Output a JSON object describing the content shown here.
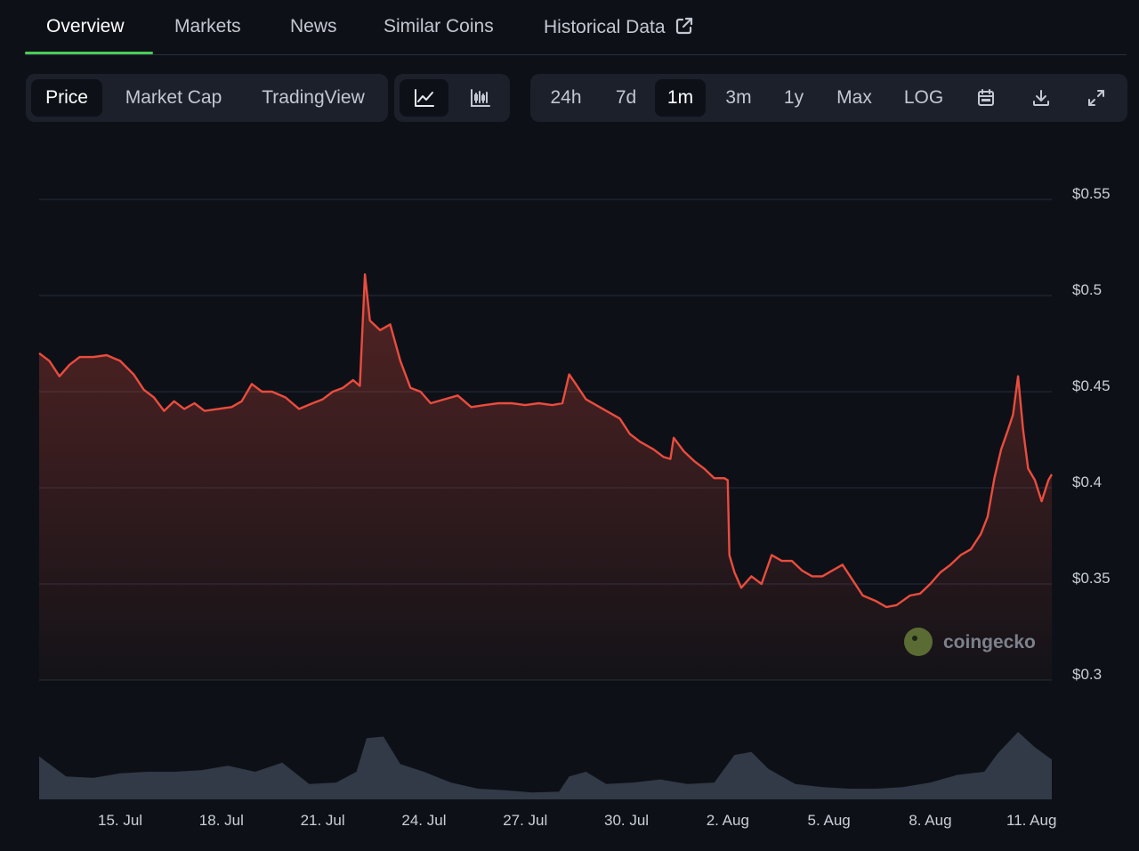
{
  "tabs": [
    {
      "label": "Overview",
      "active": true
    },
    {
      "label": "Markets",
      "active": false
    },
    {
      "label": "News",
      "active": false
    },
    {
      "label": "Similar Coins",
      "active": false
    },
    {
      "label": "Historical Data",
      "active": false
    }
  ],
  "view_toggle": [
    {
      "label": "Price",
      "active": true
    },
    {
      "label": "Market Cap",
      "active": false
    },
    {
      "label": "TradingView",
      "active": false
    }
  ],
  "chart_type_toggle": [
    {
      "icon": "line-chart-icon",
      "active": true
    },
    {
      "icon": "candlestick-chart-icon",
      "active": false
    }
  ],
  "range_toggle": [
    {
      "label": "24h",
      "active": false
    },
    {
      "label": "7d",
      "active": false
    },
    {
      "label": "1m",
      "active": true
    },
    {
      "label": "3m",
      "active": false
    },
    {
      "label": "1y",
      "active": false
    },
    {
      "label": "Max",
      "active": false
    },
    {
      "label": "LOG",
      "active": false
    }
  ],
  "tool_icons": [
    "calendar-icon",
    "download-icon",
    "fullscreen-icon"
  ],
  "watermark": "coingecko",
  "colors": {
    "line": "#ea4c3e",
    "volume": "#3a4250",
    "accent": "#4bcc57",
    "background": "#0d1117"
  },
  "chart_data": {
    "type": "line",
    "y_ticks": [
      {
        "value": 0.55,
        "label": "$0.55"
      },
      {
        "value": 0.5,
        "label": "$0.5"
      },
      {
        "value": 0.45,
        "label": "$0.45"
      },
      {
        "value": 0.4,
        "label": "$0.4"
      },
      {
        "value": 0.35,
        "label": "$0.35"
      },
      {
        "value": 0.3,
        "label": "$0.3"
      }
    ],
    "ylim": [
      0.3,
      0.55
    ],
    "x_ticks": [
      {
        "day": 15,
        "label": "15. Jul"
      },
      {
        "day": 18,
        "label": "18. Jul"
      },
      {
        "day": 21,
        "label": "21. Jul"
      },
      {
        "day": 24,
        "label": "24. Jul"
      },
      {
        "day": 27,
        "label": "27. Jul"
      },
      {
        "day": 30,
        "label": "30. Jul"
      },
      {
        "day": 33,
        "label": "2. Aug"
      },
      {
        "day": 36,
        "label": "5. Aug"
      },
      {
        "day": 39,
        "label": "8. Aug"
      },
      {
        "day": 42,
        "label": "11. Aug"
      }
    ],
    "xlim": [
      12.6,
      42.6
    ],
    "series": [
      {
        "values": [
          [
            12.6,
            0.47
          ],
          [
            12.9,
            0.466
          ],
          [
            13.2,
            0.458
          ],
          [
            13.5,
            0.464
          ],
          [
            13.8,
            0.468
          ],
          [
            14.2,
            0.468
          ],
          [
            14.6,
            0.469
          ],
          [
            15.0,
            0.466
          ],
          [
            15.4,
            0.459
          ],
          [
            15.7,
            0.451
          ],
          [
            16.0,
            0.447
          ],
          [
            16.3,
            0.44
          ],
          [
            16.6,
            0.445
          ],
          [
            16.9,
            0.441
          ],
          [
            17.2,
            0.444
          ],
          [
            17.5,
            0.44
          ],
          [
            17.9,
            0.441
          ],
          [
            18.3,
            0.442
          ],
          [
            18.6,
            0.445
          ],
          [
            18.9,
            0.454
          ],
          [
            19.2,
            0.45
          ],
          [
            19.5,
            0.45
          ],
          [
            19.9,
            0.447
          ],
          [
            20.3,
            0.441
          ],
          [
            20.7,
            0.444
          ],
          [
            21.0,
            0.446
          ],
          [
            21.3,
            0.45
          ],
          [
            21.6,
            0.452
          ],
          [
            21.9,
            0.456
          ],
          [
            22.1,
            0.453
          ],
          [
            22.25,
            0.511
          ],
          [
            22.4,
            0.487
          ],
          [
            22.7,
            0.482
          ],
          [
            23.0,
            0.485
          ],
          [
            23.3,
            0.466
          ],
          [
            23.6,
            0.452
          ],
          [
            23.9,
            0.45
          ],
          [
            24.2,
            0.444
          ],
          [
            24.6,
            0.446
          ],
          [
            25.0,
            0.448
          ],
          [
            25.4,
            0.442
          ],
          [
            25.8,
            0.443
          ],
          [
            26.2,
            0.444
          ],
          [
            26.6,
            0.444
          ],
          [
            27.0,
            0.443
          ],
          [
            27.4,
            0.444
          ],
          [
            27.8,
            0.443
          ],
          [
            28.1,
            0.444
          ],
          [
            28.3,
            0.459
          ],
          [
            28.5,
            0.454
          ],
          [
            28.8,
            0.446
          ],
          [
            29.1,
            0.443
          ],
          [
            29.4,
            0.44
          ],
          [
            29.8,
            0.436
          ],
          [
            30.1,
            0.428
          ],
          [
            30.4,
            0.424
          ],
          [
            30.8,
            0.42
          ],
          [
            31.1,
            0.416
          ],
          [
            31.3,
            0.415
          ],
          [
            31.4,
            0.426
          ],
          [
            31.7,
            0.419
          ],
          [
            32.0,
            0.414
          ],
          [
            32.3,
            0.41
          ],
          [
            32.6,
            0.405
          ],
          [
            32.9,
            0.405
          ],
          [
            33.0,
            0.404
          ],
          [
            33.05,
            0.365
          ],
          [
            33.2,
            0.356
          ],
          [
            33.4,
            0.348
          ],
          [
            33.7,
            0.354
          ],
          [
            34.0,
            0.35
          ],
          [
            34.3,
            0.365
          ],
          [
            34.6,
            0.362
          ],
          [
            34.9,
            0.362
          ],
          [
            35.2,
            0.357
          ],
          [
            35.5,
            0.354
          ],
          [
            35.8,
            0.354
          ],
          [
            36.1,
            0.357
          ],
          [
            36.4,
            0.36
          ],
          [
            36.7,
            0.352
          ],
          [
            37.0,
            0.344
          ],
          [
            37.4,
            0.341
          ],
          [
            37.7,
            0.338
          ],
          [
            38.0,
            0.339
          ],
          [
            38.4,
            0.344
          ],
          [
            38.7,
            0.345
          ],
          [
            39.0,
            0.35
          ],
          [
            39.3,
            0.356
          ],
          [
            39.6,
            0.36
          ],
          [
            39.9,
            0.365
          ],
          [
            40.2,
            0.368
          ],
          [
            40.5,
            0.376
          ],
          [
            40.7,
            0.385
          ],
          [
            40.9,
            0.405
          ],
          [
            41.1,
            0.42
          ],
          [
            41.3,
            0.43
          ],
          [
            41.45,
            0.438
          ],
          [
            41.6,
            0.458
          ],
          [
            41.75,
            0.43
          ],
          [
            41.9,
            0.41
          ],
          [
            42.1,
            0.404
          ],
          [
            42.3,
            0.393
          ],
          [
            42.5,
            0.404
          ],
          [
            42.6,
            0.407
          ]
        ]
      }
    ],
    "volume": [
      [
        12.6,
        0.56
      ],
      [
        13.4,
        0.3
      ],
      [
        14.2,
        0.28
      ],
      [
        15.0,
        0.34
      ],
      [
        15.8,
        0.36
      ],
      [
        16.6,
        0.36
      ],
      [
        17.4,
        0.38
      ],
      [
        18.2,
        0.44
      ],
      [
        19.0,
        0.36
      ],
      [
        19.8,
        0.48
      ],
      [
        20.6,
        0.2
      ],
      [
        21.4,
        0.22
      ],
      [
        22.0,
        0.36
      ],
      [
        22.3,
        0.8
      ],
      [
        22.8,
        0.82
      ],
      [
        23.3,
        0.46
      ],
      [
        24.0,
        0.36
      ],
      [
        24.8,
        0.22
      ],
      [
        25.6,
        0.14
      ],
      [
        26.4,
        0.12
      ],
      [
        27.2,
        0.09
      ],
      [
        28.0,
        0.1
      ],
      [
        28.3,
        0.3
      ],
      [
        28.8,
        0.36
      ],
      [
        29.4,
        0.2
      ],
      [
        30.2,
        0.22
      ],
      [
        31.0,
        0.26
      ],
      [
        31.8,
        0.2
      ],
      [
        32.6,
        0.22
      ],
      [
        33.2,
        0.58
      ],
      [
        33.7,
        0.62
      ],
      [
        34.2,
        0.4
      ],
      [
        35.0,
        0.2
      ],
      [
        35.8,
        0.16
      ],
      [
        36.6,
        0.14
      ],
      [
        37.4,
        0.14
      ],
      [
        38.2,
        0.16
      ],
      [
        39.0,
        0.22
      ],
      [
        39.8,
        0.32
      ],
      [
        40.6,
        0.36
      ],
      [
        41.0,
        0.6
      ],
      [
        41.6,
        0.88
      ],
      [
        42.1,
        0.68
      ],
      [
        42.6,
        0.52
      ]
    ]
  }
}
